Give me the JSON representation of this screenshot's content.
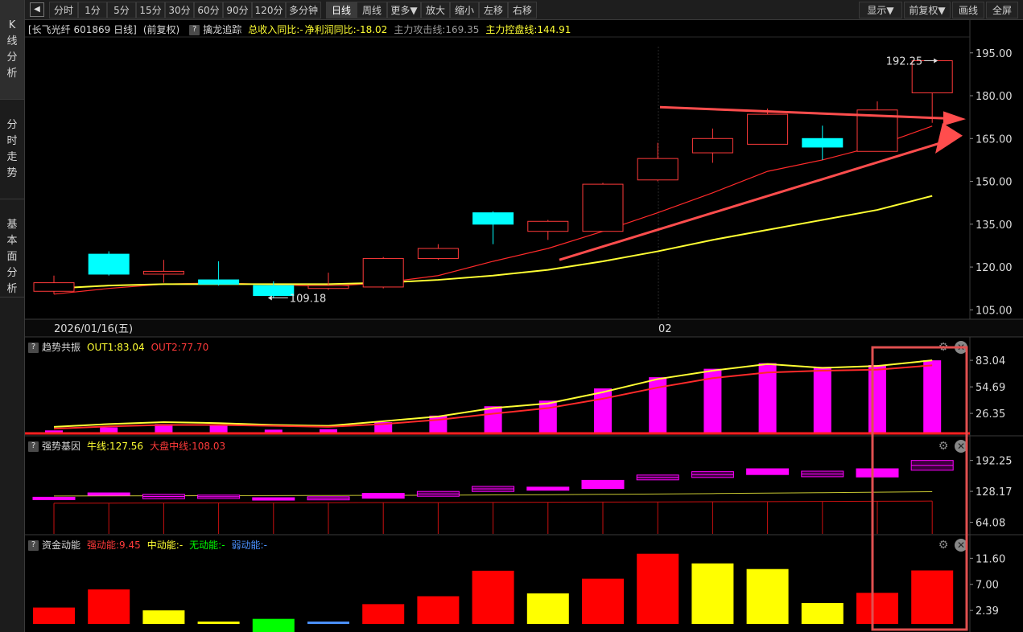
{
  "leftnav": [
    {
      "label": "K线分析",
      "active": true
    },
    {
      "label": "分时走势",
      "active": false
    },
    {
      "label": "基本面分析",
      "active": false
    }
  ],
  "toolbar": {
    "collapse_icon": "◀",
    "left": [
      "分时",
      "1分",
      "5分",
      "15分",
      "30分",
      "60分",
      "90分",
      "120分",
      "多分钟",
      "日线",
      "周线",
      "更多▼",
      "放大",
      "缩小",
      "左移",
      "右移"
    ],
    "active": "日线",
    "right": [
      "显示▼",
      "前复权▼",
      "画线",
      "全屏"
    ]
  },
  "main_header": {
    "stock": "[长飞光纤 601869 日线]",
    "adj": "(前复权)",
    "indicator": "擒龙追踪",
    "revenue": "总收入同比:-",
    "profit": "净利润同比:-18.02",
    "attack": "主力攻击线:169.35",
    "control": "主力控盘线:144.91"
  },
  "panel2_header": {
    "name": "趋势共振",
    "out1": "OUT1:83.04",
    "out2": "OUT2:77.70"
  },
  "panel3_header": {
    "name": "强势基因",
    "bull": "牛线:127.56",
    "market": "大盘中线:108.03"
  },
  "panel4_header": {
    "name": "资金动能",
    "strong": "强动能:9.45",
    "mid": "中动能:-",
    "none": "无动能:-",
    "weak": "弱动能:-"
  },
  "colors": {
    "up": "#ff3a3a",
    "down": "#00ffff",
    "ma_yellow": "#ffff33",
    "ma_red": "#ff2a2a",
    "magenta": "#ff00ff",
    "bar_red": "#ff0000",
    "bar_yellow": "#ffff00",
    "bar_green": "#00ff00",
    "bar_blue": "#4a90ff",
    "arrow": "#ff4d4d",
    "highlight_box": "#e05050"
  },
  "chart_data": [
    {
      "type": "candlestick",
      "title": "长飞光纤 601869 日线",
      "x_labels": [
        "2026/01/16(五)",
        "02"
      ],
      "ylim": [
        102,
        200
      ],
      "yticks": [
        "195.00",
        "180.00",
        "165.00",
        "150.00",
        "135.00",
        "120.00",
        "105.00"
      ],
      "candles": [
        {
          "o": 111.5,
          "c": 114.5,
          "h": 117.0,
          "l": 110.5,
          "dir": "up"
        },
        {
          "o": 124.5,
          "c": 117.5,
          "h": 125.5,
          "l": 117.0,
          "dir": "down"
        },
        {
          "o": 117.5,
          "c": 118.5,
          "h": 122.5,
          "l": 114.5,
          "dir": "up"
        },
        {
          "o": 115.5,
          "c": 114.0,
          "h": 122.0,
          "l": 113.5,
          "dir": "down"
        },
        {
          "o": 113.5,
          "c": 110.0,
          "h": 115.0,
          "l": 109.18,
          "dir": "down"
        },
        {
          "o": 112.5,
          "c": 113.5,
          "h": 118.0,
          "l": 112.0,
          "dir": "up"
        },
        {
          "o": 113.0,
          "c": 123.0,
          "h": 123.5,
          "l": 112.5,
          "dir": "up"
        },
        {
          "o": 123.0,
          "c": 126.5,
          "h": 128.0,
          "l": 122.5,
          "dir": "up"
        },
        {
          "o": 139.0,
          "c": 135.0,
          "h": 139.5,
          "l": 128.0,
          "dir": "down"
        },
        {
          "o": 132.5,
          "c": 136.0,
          "h": 136.5,
          "l": 129.5,
          "dir": "up"
        },
        {
          "o": 132.5,
          "c": 149.0,
          "h": 149.5,
          "l": 132.5,
          "dir": "up"
        },
        {
          "o": 150.5,
          "c": 158.0,
          "h": 163.5,
          "l": 150.0,
          "dir": "up"
        },
        {
          "o": 160.0,
          "c": 165.0,
          "h": 168.5,
          "l": 156.5,
          "dir": "up"
        },
        {
          "o": 163.0,
          "c": 173.5,
          "h": 175.5,
          "l": 163.0,
          "dir": "up"
        },
        {
          "o": 165.0,
          "c": 162.0,
          "h": 169.5,
          "l": 157.5,
          "dir": "down"
        },
        {
          "o": 160.5,
          "c": 175.0,
          "h": 178.0,
          "l": 160.5,
          "dir": "up"
        },
        {
          "o": 181.0,
          "c": 192.25,
          "h": 192.25,
          "l": 170.5,
          "dir": "up"
        }
      ],
      "series": [
        {
          "name": "主力攻击线",
          "color": "#ff2a2a",
          "values": [
            110.5,
            112.5,
            114.0,
            114.5,
            113.8,
            113.2,
            114.5,
            117.0,
            122.0,
            126.5,
            132.5,
            139.0,
            146.0,
            153.5,
            157.5,
            162.5,
            169.35
          ]
        },
        {
          "name": "主力控盘线",
          "color": "#ffff33",
          "values": [
            112.5,
            113.5,
            114.0,
            114.0,
            114.0,
            114.0,
            114.5,
            115.5,
            117.0,
            119.0,
            122.0,
            125.5,
            129.5,
            133.0,
            136.5,
            140.0,
            144.91
          ]
        }
      ],
      "annotations": [
        {
          "text": "192.25",
          "at": 16,
          "value": 192.25
        },
        {
          "text": "109.18",
          "at": 4,
          "value": 109.18
        }
      ]
    },
    {
      "type": "bar+line",
      "title": "趋势共振",
      "ylim": [
        5,
        90
      ],
      "yticks": [
        "83.04",
        "54.69",
        "26.35"
      ],
      "bars": [
        8.2,
        11.5,
        15.0,
        14.0,
        9.0,
        9.5,
        17.0,
        24.0,
        34.0,
        40.0,
        53.0,
        65.0,
        74.0,
        80.0,
        76.0,
        78.0,
        83.04
      ],
      "series": [
        {
          "name": "OUT1",
          "color": "#ffff33",
          "values": [
            12.0,
            15.0,
            17.0,
            16.0,
            14.0,
            13.0,
            18.0,
            23.0,
            32.0,
            37.0,
            49.0,
            63.0,
            72.0,
            79.0,
            75.0,
            77.0,
            83.04
          ]
        },
        {
          "name": "OUT2",
          "color": "#ff2a2a",
          "values": [
            10.0,
            12.5,
            14.0,
            14.0,
            13.0,
            12.0,
            15.0,
            19.5,
            26.0,
            32.0,
            42.0,
            54.0,
            64.0,
            70.0,
            72.0,
            73.0,
            77.7
          ]
        }
      ]
    },
    {
      "type": "bar",
      "title": "强势基因",
      "ylim": [
        40,
        205
      ],
      "yticks": [
        "192.25",
        "128.17",
        "64.08"
      ],
      "blocks": [
        {
          "a": 112.5,
          "b": 116.0,
          "filled": true
        },
        {
          "a": 120.0,
          "b": 125.0,
          "filled": true
        },
        {
          "a": 113.0,
          "b": 122.0,
          "filled": false
        },
        {
          "a": 113.5,
          "b": 120.5,
          "filled": false
        },
        {
          "a": 110.0,
          "b": 115.0,
          "filled": true
        },
        {
          "a": 110.5,
          "b": 117.0,
          "filled": false
        },
        {
          "a": 114.0,
          "b": 124.0,
          "filled": true
        },
        {
          "a": 118.0,
          "b": 128.0,
          "filled": false
        },
        {
          "a": 128.0,
          "b": 138.5,
          "filled": false
        },
        {
          "a": 130.5,
          "b": 137.0,
          "filled": true
        },
        {
          "a": 134.0,
          "b": 151.0,
          "filled": true
        },
        {
          "a": 152.0,
          "b": 162.0,
          "filled": false
        },
        {
          "a": 157.0,
          "b": 169.0,
          "filled": false
        },
        {
          "a": 163.0,
          "b": 175.0,
          "filled": true
        },
        {
          "a": 158.5,
          "b": 170.0,
          "filled": false
        },
        {
          "a": 158.0,
          "b": 175.0,
          "filled": true
        },
        {
          "a": 172.0,
          "b": 192.25,
          "filled": false
        }
      ],
      "series": [
        {
          "name": "牛线",
          "color": "#ffff33",
          "values": [
            118.5,
            118.8,
            119.0,
            119.2,
            119.4,
            119.6,
            119.9,
            120.3,
            120.8,
            121.3,
            122.0,
            122.8,
            123.6,
            124.5,
            125.5,
            126.4,
            127.56
          ]
        },
        {
          "name": "大盘中线",
          "color": "#ff2a2a",
          "values": [
            103.5,
            103.8,
            104.1,
            104.3,
            104.5,
            104.7,
            104.9,
            105.1,
            105.4,
            105.7,
            106.0,
            106.3,
            106.6,
            106.9,
            107.3,
            107.7,
            108.03
          ]
        }
      ]
    },
    {
      "type": "bar",
      "title": "资金动能",
      "ylim": [
        0,
        12.5
      ],
      "yticks": [
        "11.60",
        "7.00",
        "2.39"
      ],
      "values": [
        2.9,
        6.1,
        2.4,
        0.35,
        0.9,
        0.3,
        3.5,
        4.9,
        9.4,
        5.4,
        8.0,
        12.4,
        10.7,
        9.7,
        3.7,
        5.5,
        9.45
      ],
      "kinds": [
        "red",
        "red",
        "yellow",
        "yellow",
        "green",
        "blue",
        "red",
        "red",
        "red",
        "yellow",
        "red",
        "red",
        "yellow",
        "yellow",
        "yellow",
        "red",
        "red"
      ]
    }
  ]
}
